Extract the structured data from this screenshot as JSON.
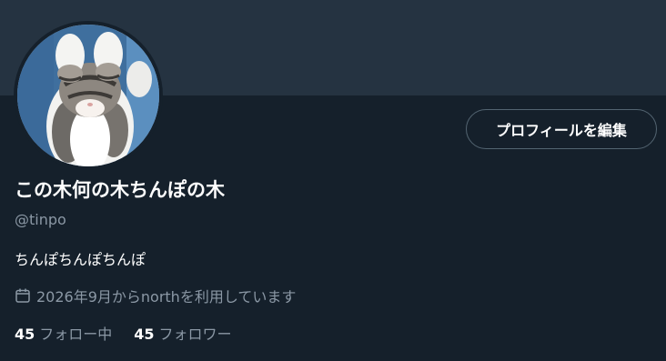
{
  "profile": {
    "display_name": "この木何の木ちんぽの木",
    "handle": "@tinpo",
    "bio": "ちんぽちんぽちんぽ",
    "joined": "2026年9月からnorthを利用しています",
    "edit_button_label": "プロフィールを編集",
    "avatar_icon": "cat-photo",
    "calendar_icon": "calendar-icon"
  },
  "stats": {
    "following_count": "45",
    "following_label": "フォロー中",
    "followers_count": "45",
    "followers_label": "フォロワー"
  },
  "colors": {
    "background": "#15202b",
    "banner": "#253341",
    "secondary_text": "#8b98a5",
    "button_border": "#536471"
  }
}
